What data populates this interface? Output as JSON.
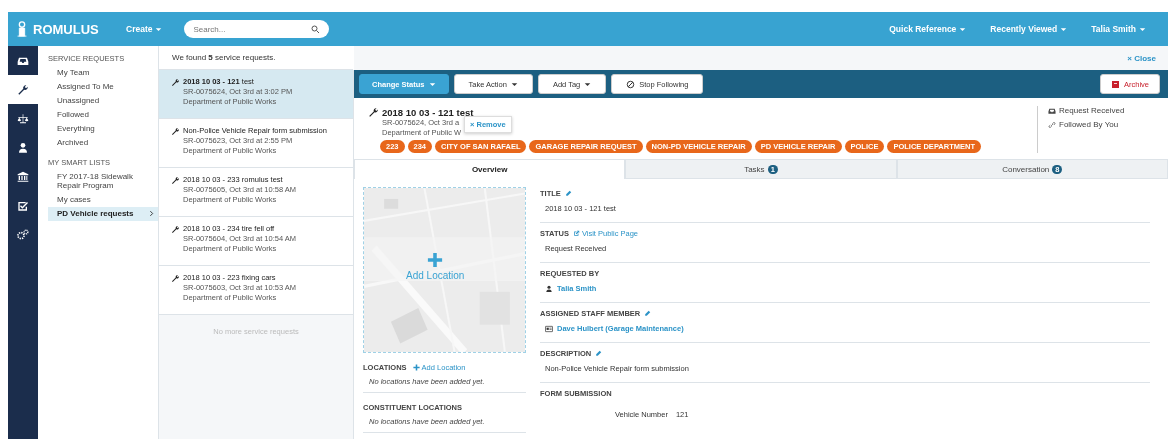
{
  "topbar": {
    "brand": "ROMULUS",
    "create": "Create",
    "search": {
      "placeholder": "Search..."
    },
    "menus": [
      "Quick Reference",
      "Recently Viewed",
      "Talia Smith"
    ]
  },
  "rail": [
    {
      "selected": false
    },
    {
      "selected": true
    },
    {
      "selected": false
    },
    {
      "selected": false
    },
    {
      "selected": false
    },
    {
      "selected": false
    },
    {
      "selected": false
    }
  ],
  "sidebar": {
    "sections": [
      {
        "heading": "SERVICE REQUESTS",
        "items": [
          {
            "label": "My Team",
            "selected": false
          },
          {
            "label": "Assigned To Me",
            "selected": false
          },
          {
            "label": "Unassigned",
            "selected": false
          },
          {
            "label": "Followed",
            "selected": false
          },
          {
            "label": "Everything",
            "selected": false
          },
          {
            "label": "Archived",
            "selected": false
          }
        ]
      },
      {
        "heading": "MY SMART LISTS",
        "items": [
          {
            "label": "FY 2017-18 Sidewalk Repair Program",
            "selected": false
          },
          {
            "label": "My cases",
            "selected": false
          },
          {
            "label": "PD Vehicle requests",
            "selected": true
          }
        ]
      }
    ]
  },
  "results": {
    "summary": "We found **5** service requests.",
    "requests": [
      {
        "title": "**2018 10 03 - 121** test",
        "meta": "SR-0075624, Oct 3rd at 3:02 PM",
        "department": "Department of Public Works",
        "selected": true
      },
      {
        "title": "Non-Police Vehicle Repair form submission",
        "meta": "SR-0075623, Oct 3rd at 2:55 PM",
        "department": "Department of Public Works",
        "selected": false
      },
      {
        "title": "2018 10 03 - 233 romulus test",
        "meta": "SR-0075605, Oct 3rd at 10:58 AM",
        "department": "Department of Public Works",
        "selected": false
      },
      {
        "title": "2018 10 03 - 234 tire fell off",
        "meta": "SR-0075604, Oct 3rd at 10:54 AM",
        "department": "Department of Public Works",
        "selected": false
      },
      {
        "title": "2018 10 03 - 223 fixing cars",
        "meta": "SR-0075603, Oct 3rd at 10:53 AM",
        "department": "Department of Public Works",
        "selected": false
      }
    ],
    "end_note": "No more service requests"
  },
  "detail": {
    "close": "× Close",
    "toolbar": [
      "Change Status",
      "Take Action",
      "Add Tag",
      "Stop Following"
    ],
    "archive": "Archive",
    "title": "2018 10 03 - 121 test",
    "meta": "SR-0075624, Oct 3rd a",
    "department": "Department of Public W",
    "tooltip": "× Remove",
    "tags": [
      "223",
      "234",
      "CITY OF SAN RAFAEL",
      "GARAGE REPAIR REQUEST",
      "NON-PD VEHICLE REPAIR",
      "PD VEHICLE REPAIR",
      "POLICE",
      "POLICE DEPARTMENT"
    ],
    "status_flags": [
      "Request Received",
      "Followed By You"
    ],
    "tabs": [
      {
        "label": "Overview",
        "selected": true
      },
      {
        "label": "Tasks",
        "badge": "1",
        "selected": false
      },
      {
        "label": "Conversation",
        "badge": "8",
        "selected": false
      }
    ],
    "map": {
      "kind": "picture",
      "add_location": "Add Location"
    },
    "locations": [
      {
        "heading": "LOCATIONS",
        "link": "Add Location",
        "empty": "No locations have been added yet."
      },
      {
        "heading": "CONSTITUENT LOCATIONS",
        "empty": "No locations have been added yet."
      }
    ],
    "fields": [
      {
        "label": "TITLE",
        "editable": true,
        "kind": "text",
        "value": "2018 10 03 - 121 test"
      },
      {
        "label": "STATUS",
        "link": "Visit Public Page",
        "kind": "text",
        "value": "Request Received"
      },
      {
        "label": "REQUESTED BY",
        "kind": "person",
        "value": "Talia Smith"
      },
      {
        "label": "ASSIGNED STAFF MEMBER",
        "editable": true,
        "kind": "staff",
        "value": "Dave Hulbert (Garage Maintenance)"
      },
      {
        "label": "DESCRIPTION",
        "editable": true,
        "kind": "text",
        "value": "Non-Police Vehicle Repair form submission"
      },
      {
        "label": "FORM SUBMISSION",
        "kind": "form",
        "rows": [
          {
            "name": "Vehicle Number",
            "value": "121"
          }
        ]
      }
    ]
  }
}
